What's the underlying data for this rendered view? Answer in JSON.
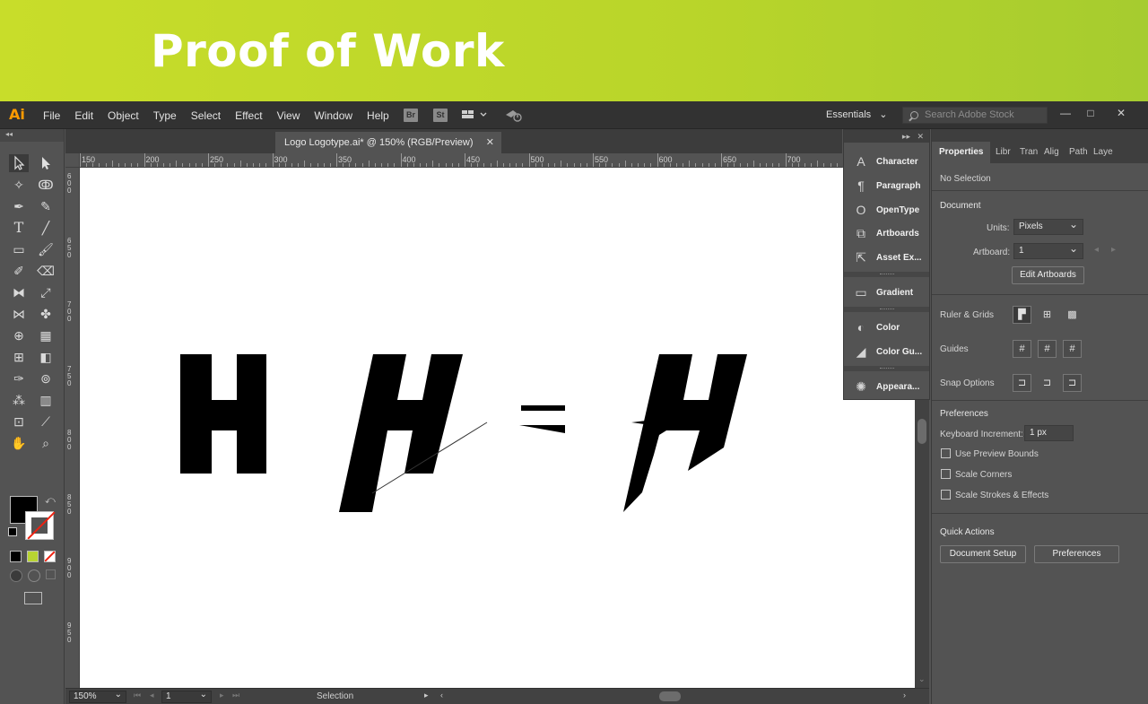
{
  "banner": {
    "title": "Proof of Work"
  },
  "menubar": {
    "app_logo": "Ai",
    "items": [
      "File",
      "Edit",
      "Object",
      "Type",
      "Select",
      "Effect",
      "View",
      "Window",
      "Help"
    ],
    "bridge_label": "Br",
    "stock_label": "St",
    "workspace": "Essentials",
    "search_placeholder": "Search Adobe Stock",
    "minimize": "—",
    "restore": "□",
    "close": "✕"
  },
  "document": {
    "tab_title": "Logo Logotype.ai* @ 150% (RGB/Preview)",
    "tab_close": "✕"
  },
  "ruler": {
    "h_ticks": [
      "150",
      "200",
      "250",
      "300",
      "350",
      "400",
      "450",
      "500",
      "550",
      "600",
      "650",
      "700"
    ],
    "v_ticks": [
      "600",
      "650",
      "700",
      "750",
      "800",
      "850",
      "900",
      "950"
    ]
  },
  "statusbar": {
    "zoom": "150%",
    "artboard_number": "1",
    "tool_status": "Selection"
  },
  "dock": {
    "items": [
      {
        "label": "Character",
        "icon": "character-icon",
        "glyph": "A"
      },
      {
        "label": "Paragraph",
        "icon": "paragraph-icon",
        "glyph": "¶"
      },
      {
        "label": "OpenType",
        "icon": "opentype-icon",
        "glyph": "O"
      },
      {
        "label": "Artboards",
        "icon": "artboards-icon",
        "glyph": "⧉"
      },
      {
        "label": "Asset Ex...",
        "icon": "asset-export-icon",
        "glyph": "⇱"
      },
      {
        "label": "Gradient",
        "icon": "gradient-icon",
        "glyph": "▭"
      },
      {
        "label": "Color",
        "icon": "color-icon",
        "glyph": "◐"
      },
      {
        "label": "Color Gu...",
        "icon": "color-guide-icon",
        "glyph": "◢"
      },
      {
        "label": "Appeara...",
        "icon": "appearance-icon",
        "glyph": "✺"
      }
    ]
  },
  "properties": {
    "tabs": [
      "Properties",
      "Libr",
      "Tran",
      "Alig",
      "Path",
      "Laye"
    ],
    "selection": "No Selection",
    "document_title": "Document",
    "units_label": "Units:",
    "units_value": "Pixels",
    "artboard_label": "Artboard:",
    "artboard_value": "1",
    "edit_artboards": "Edit Artboards",
    "ruler_grids": "Ruler & Grids",
    "guides": "Guides",
    "snap_options": "Snap Options",
    "preferences_title": "Preferences",
    "keyboard_increment_label": "Keyboard Increment:",
    "keyboard_increment_value": "1 px",
    "use_preview_bounds": "Use Preview Bounds",
    "scale_corners": "Scale Corners",
    "scale_strokes": "Scale Strokes & Effects",
    "quick_actions": "Quick Actions",
    "document_setup": "Document Setup",
    "preferences_btn": "Preferences"
  },
  "artwork": {
    "equals": "="
  },
  "colors": {
    "banner_start": "#c8dd2a",
    "banner_end": "#a6cc2f",
    "ai_logo": "#ff9a00",
    "swatch_green": "#b8d433"
  }
}
